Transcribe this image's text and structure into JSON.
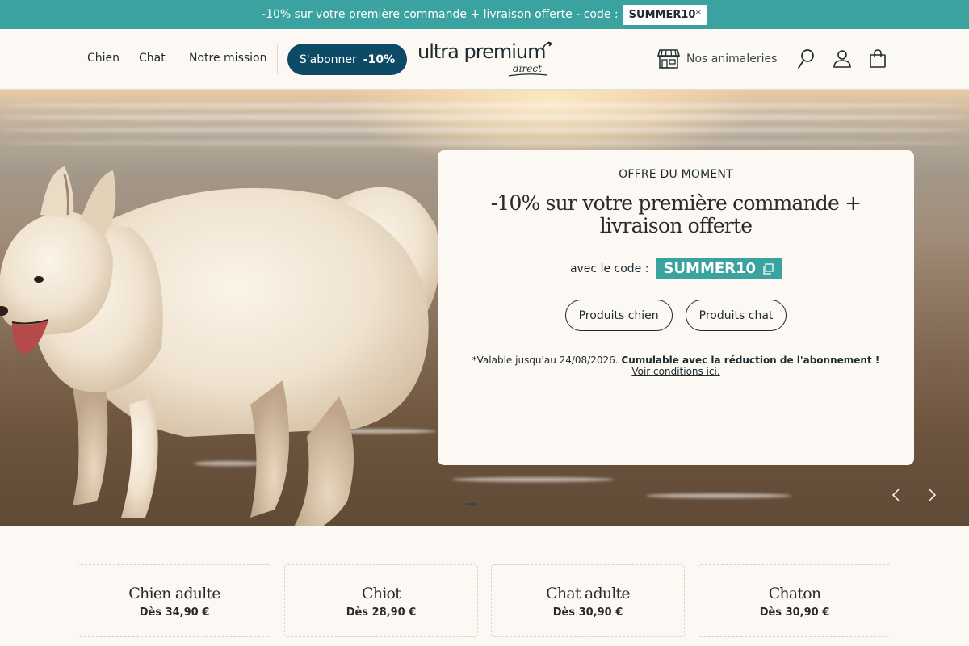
{
  "promo_bar": {
    "text": "-10% sur votre première commande + livraison offerte - code :",
    "code": "SUMMER10",
    "asterisk": "*"
  },
  "nav": {
    "items": [
      {
        "label": "Chien"
      },
      {
        "label": "Chat"
      },
      {
        "label": "Notre mission"
      }
    ],
    "subscribe": {
      "label": "S'abonner",
      "discount": "-10%"
    },
    "logo": {
      "main": "ultra premium",
      "sub": "direct"
    },
    "store_link": "Nos animaleries",
    "icons": [
      "store-icon",
      "search-icon",
      "account-icon",
      "cart-icon"
    ]
  },
  "hero": {
    "eyebrow": "OFFRE DU MOMENT",
    "title": "-10% sur votre première commande + livraison offerte",
    "code_label": "avec le code :",
    "code": "SUMMER10",
    "buttons": [
      {
        "label": "Produits chien"
      },
      {
        "label": "Produits chat"
      }
    ],
    "note_prefix": "*Valable jusqu'au 24/08/2026.",
    "note_bold": "Cumulable avec la réduction de l'abonnement !",
    "conditions_link": "Voir conditions ici.",
    "slide_current": 1
  },
  "categories": [
    {
      "name": "Chien adulte",
      "price": "Dès 34,90 €"
    },
    {
      "name": "Chiot",
      "price": "Dès 28,90 €"
    },
    {
      "name": "Chat adulte",
      "price": "Dès 30,90 €"
    },
    {
      "name": "Chaton",
      "price": "Dès 30,90 €"
    }
  ],
  "colors": {
    "teal": "#3aa39f",
    "navy": "#0c4a66",
    "cream": "#fcf9f5",
    "text": "#1f2a2e"
  }
}
